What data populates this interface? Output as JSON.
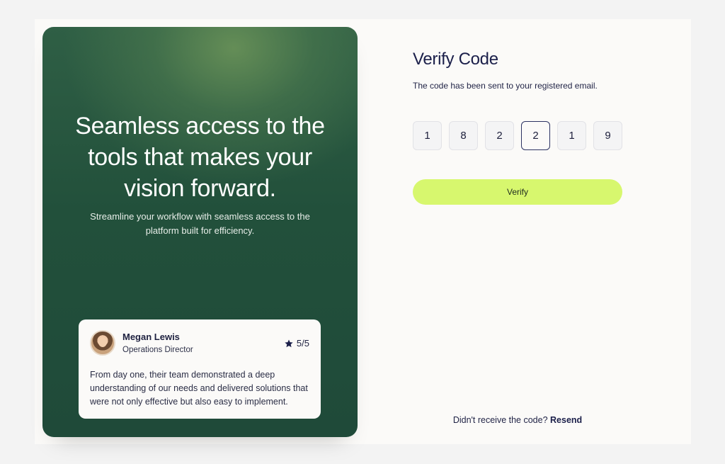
{
  "hero": {
    "title": "Seamless access to the tools that makes your vision forward.",
    "subtitle": "Streamline your workflow with seamless access to the platform built for efficiency."
  },
  "testimonial": {
    "name": "Megan Lewis",
    "role": "Operations Director",
    "rating": "5/5",
    "rating_icon": "star-icon",
    "quote": "From day one, their team demonstrated a deep understanding of our needs and delivered solutions that were not only effective but also easy to implement."
  },
  "verify": {
    "title": "Verify Code",
    "subtitle": "The code has been sent to your registered email.",
    "code": [
      "1",
      "8",
      "2",
      "2",
      "1",
      "9"
    ],
    "active_index": 3,
    "button_label": "Verify",
    "resend_prompt": "Didn't receive the code?",
    "resend_link": "Resend"
  },
  "colors": {
    "accent": "#d7f76e",
    "hero_green": "#22503b",
    "text_navy": "#1b1f4a"
  }
}
